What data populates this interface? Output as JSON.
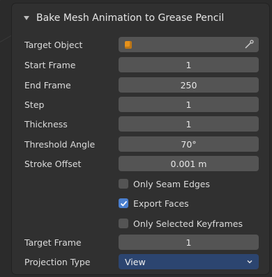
{
  "panel": {
    "title": "Bake Mesh Animation to Grease Pencil"
  },
  "fields": {
    "target_object": {
      "label": "Target Object",
      "value": "",
      "icon": "object-icon"
    },
    "start_frame": {
      "label": "Start Frame",
      "value": "1"
    },
    "end_frame": {
      "label": "End Frame",
      "value": "250"
    },
    "step": {
      "label": "Step",
      "value": "1"
    },
    "thickness": {
      "label": "Thickness",
      "value": "1"
    },
    "threshold_angle": {
      "label": "Threshold Angle",
      "value": "70°"
    },
    "stroke_offset": {
      "label": "Stroke Offset",
      "value": "0.001 m"
    },
    "target_frame": {
      "label": "Target Frame",
      "value": "1"
    },
    "projection_type": {
      "label": "Projection Type",
      "value": "View"
    }
  },
  "checkboxes": {
    "only_seam_edges": {
      "label": "Only Seam Edges",
      "checked": false
    },
    "export_faces": {
      "label": "Export Faces",
      "checked": true
    },
    "only_selected_keyframes": {
      "label": "Only Selected Keyframes",
      "checked": false
    }
  },
  "colors": {
    "panel_bg": "#303030",
    "field_bg": "#545454",
    "select_bg": "#2c4570",
    "checkbox_on": "#4a7fcf",
    "object_icon": "#e6911b"
  }
}
